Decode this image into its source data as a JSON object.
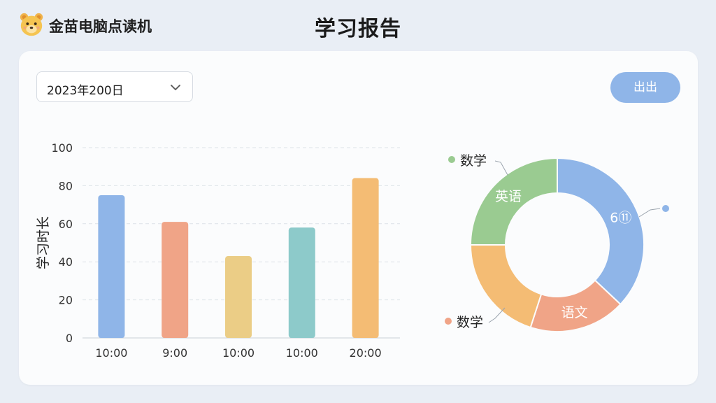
{
  "app": {
    "name": "金苗电脑点读机",
    "logo_icon": "bear-face-icon",
    "page_title": "学习报告"
  },
  "toolbar": {
    "date_value": "2023年200日",
    "date_dropdown_icon": "chevron-down-icon",
    "export_label": "出出"
  },
  "colors": {
    "page_bg": "#e9eef5",
    "card_bg": "#fbfcfd",
    "export_button": "#8fb5e8",
    "blue": "#8fb5e8",
    "salmon": "#f0a487",
    "yellow": "#ebcd86",
    "teal": "#8dcaca",
    "orange": "#f4bc74",
    "green": "#9acb91"
  },
  "chart_data": [
    {
      "type": "bar",
      "ylabel": "学习时长",
      "xlabel": "",
      "ylim": [
        0,
        100
      ],
      "yticks": [
        0,
        20,
        40,
        60,
        80,
        100
      ],
      "grid": true,
      "categories": [
        "10:00",
        "9:00",
        "10:00",
        "10:00",
        "20:00"
      ],
      "values": [
        75,
        61,
        43,
        58,
        84
      ],
      "bar_colors": [
        "#8fb5e8",
        "#f0a487",
        "#ebcd86",
        "#8dcaca",
        "#f4bc74"
      ]
    },
    {
      "type": "pie",
      "donut": true,
      "slices": [
        {
          "label": "6⑪",
          "value": 37,
          "color": "#8fb5e8"
        },
        {
          "label": "语文",
          "value": 18,
          "color": "#f0a487"
        },
        {
          "label": "",
          "value": 20,
          "color": "#f4bc74"
        },
        {
          "label": "英语",
          "value": 25,
          "color": "#9acb91"
        }
      ],
      "legend": [
        {
          "label": "数学",
          "color": "#9acb91"
        },
        {
          "label": "",
          "color": "#8fb5e8"
        },
        {
          "label": "数学",
          "color": "#f0a487"
        }
      ]
    }
  ]
}
